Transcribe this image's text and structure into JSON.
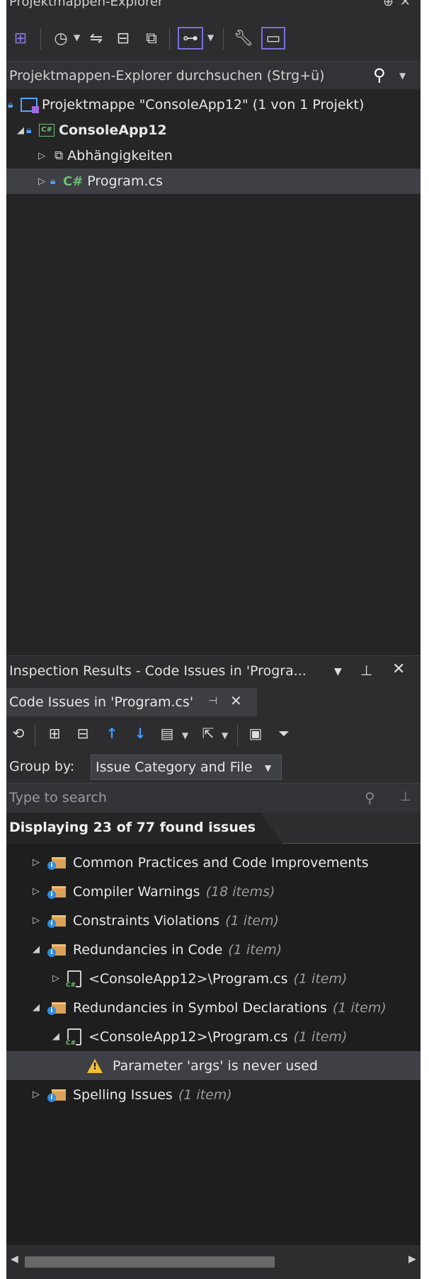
{
  "solution_explorer": {
    "title": "Projektmappen-Explorer",
    "pin_glyph": "⊕",
    "close_glyph": "✕",
    "search_placeholder": "Projektmappen-Explorer durchsuchen (Strg+ü)",
    "tree": [
      {
        "label": "Projektmappe \"ConsoleApp12\" (1 von 1 Projekt)",
        "kind": "solution"
      },
      {
        "label": "ConsoleApp12",
        "kind": "project"
      },
      {
        "label": "Abhängigkeiten",
        "kind": "dependencies"
      },
      {
        "label": "Program.cs",
        "kind": "file"
      }
    ]
  },
  "inspection": {
    "title": "Inspection Results - Code Issues in 'Progra...",
    "tab_label": "Code Issues in 'Program.cs'",
    "group_by_label": "Group by:",
    "group_by_value": "Issue Category and File",
    "search_placeholder": "Type to search",
    "summary": "Displaying 23 of 77 found issues",
    "items": [
      {
        "label": "Common Practices and Code Improvements",
        "count": ""
      },
      {
        "label": "Compiler Warnings",
        "count": "(18 items)"
      },
      {
        "label": "Constraints Violations",
        "count": "(1 item)"
      },
      {
        "label": "Redundancies in Code",
        "count": "(1 item)"
      },
      {
        "label": "<ConsoleApp12>\\Program.cs",
        "count": "(1 item)"
      },
      {
        "label": "Redundancies in Symbol Declarations",
        "count": "(1 item)"
      },
      {
        "label": "<ConsoleApp12>\\Program.cs",
        "count": "(1 item)"
      },
      {
        "label": "Parameter 'args' is never used",
        "count": ""
      },
      {
        "label": "Spelling Issues",
        "count": "(1 item)"
      }
    ]
  },
  "colors": {
    "background": "#1e1e1e",
    "panel": "#2d2d30",
    "selection": "#3f3f46",
    "accent": "#7a6fe0",
    "csharp_green": "#6dbf73",
    "warning": "#f2c230",
    "lock_blue": "#4fa3ff"
  }
}
